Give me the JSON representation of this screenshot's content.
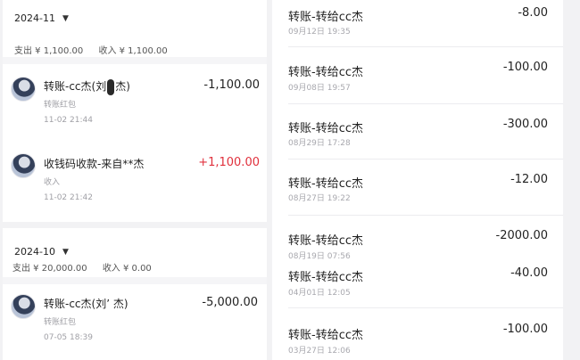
{
  "left_top": {
    "month": "2024-11",
    "summary_expense": "支出 ¥ 1,100.00",
    "summary_income": "收入 ¥ 1,100.00",
    "transactions": [
      {
        "title_a": "转账-cc杰(刘",
        "title_b": "杰)",
        "sub": "转账红包",
        "time": "11-02 21:44",
        "amount": "-1,100.00",
        "redacted": true
      },
      {
        "title": "收钱码收款-来自**杰",
        "sub": "收入",
        "time": "11-02 21:42",
        "amount": "+1,100.00"
      }
    ]
  },
  "left_bottom": {
    "month": "2024-10",
    "summary_expense": "支出 ¥ 20,000.00",
    "summary_income": "收入 ¥ 0.00",
    "transactions": [
      {
        "title": "转账-cc杰(刘’ 杰)",
        "sub": "转账红包",
        "time": "07-05 18:39",
        "amount": "-5,000.00"
      }
    ]
  },
  "right": {
    "items": [
      {
        "title": "转账-转给cc杰",
        "date": "09月12日 19:35",
        "amount": "-8.00"
      },
      {
        "title": "转账-转给cc杰",
        "date": "09月08日 19:57",
        "amount": "-100.00"
      },
      {
        "title": "转账-转给cc杰",
        "date": "08月29日 17:28",
        "amount": "-300.00"
      },
      {
        "title": "转账-转给cc杰",
        "date": "08月27日 19:22",
        "amount": "-12.00"
      },
      {
        "title": "转账-转给cc杰",
        "date": "08月19日 07:56",
        "amount": "-2000.00"
      },
      {
        "title": "转账-转给cc杰",
        "date": "04月01日 12:05",
        "amount": "-40.00"
      },
      {
        "title": "转账-转给cc杰",
        "date": "03月27日 12:06",
        "amount": "-100.00"
      }
    ]
  }
}
